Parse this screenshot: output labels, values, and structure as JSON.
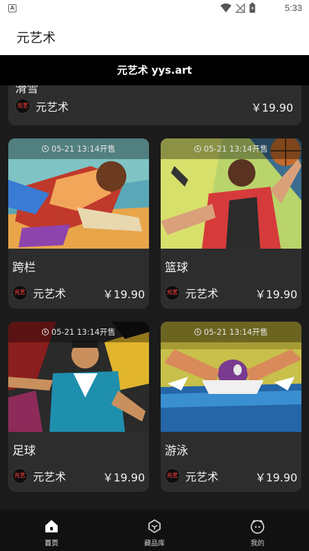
{
  "status_bar": {
    "time": "5:33",
    "notification_icon": "A"
  },
  "app_bar": {
    "title": "元艺术"
  },
  "page_header": {
    "site_title": "元艺术 yys.art"
  },
  "colors": {
    "background": "#1b1b1b",
    "card": "#2d2d2d",
    "header": "#000000",
    "nav": "#111111"
  },
  "partial_card": {
    "title": "滑雪",
    "brand": "元艺术",
    "logo_text": "元艺",
    "price": "￥19.90"
  },
  "cards": [
    {
      "title": "跨栏",
      "sale_time": "05-21 13:14开售",
      "brand": "元艺术",
      "logo_text": "元艺",
      "price": "￥19.90"
    },
    {
      "title": "篮球",
      "sale_time": "05-21 13:14开售",
      "brand": "元艺术",
      "logo_text": "元艺",
      "price": "￥19.90"
    },
    {
      "title": "足球",
      "sale_time": "05-21 13:14开售",
      "brand": "元艺术",
      "logo_text": "元艺",
      "price": "￥19.90"
    },
    {
      "title": "游泳",
      "sale_time": "05-21 13:14开售",
      "brand": "元艺术",
      "logo_text": "元艺",
      "price": "￥19.90"
    }
  ],
  "bottom_nav": [
    {
      "label": "首页",
      "icon": "home-icon",
      "active": true
    },
    {
      "label": "藏品库",
      "icon": "collection-icon",
      "active": false
    },
    {
      "label": "我的",
      "icon": "profile-icon",
      "active": false
    }
  ]
}
